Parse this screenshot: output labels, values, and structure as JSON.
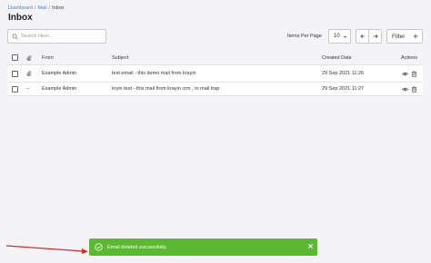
{
  "breadcrumb": {
    "items": [
      "Dashboard",
      "Mail",
      "Inbox"
    ]
  },
  "page_title": "Inbox",
  "search": {
    "placeholder": "Search Here..."
  },
  "pagination": {
    "items_per_page_label": "Items Per Page",
    "items_per_page_value": "10"
  },
  "toolbar": {
    "filter_label": "Filter"
  },
  "table": {
    "headers": {
      "from": "From",
      "subject": "Subject",
      "created_date": "Created Date",
      "actions": "Actions"
    },
    "rows": [
      {
        "attachment": "paperclip-icon",
        "from": "Example Admin",
        "subject": "test email - this demo mail from krayin",
        "created_date": "29 Sep 2021 11:26"
      },
      {
        "attachment": "--",
        "from": "Example Admin",
        "subject": "kryin test - this mail from krayin crm , to mail trap",
        "created_date": "29 Sep 2021 11:27"
      }
    ]
  },
  "toast": {
    "message": "Email deleted successfully.",
    "color": "#5cb832"
  },
  "colors": {
    "link": "#3b86e6",
    "annotation_arrow": "#d62d2d"
  }
}
